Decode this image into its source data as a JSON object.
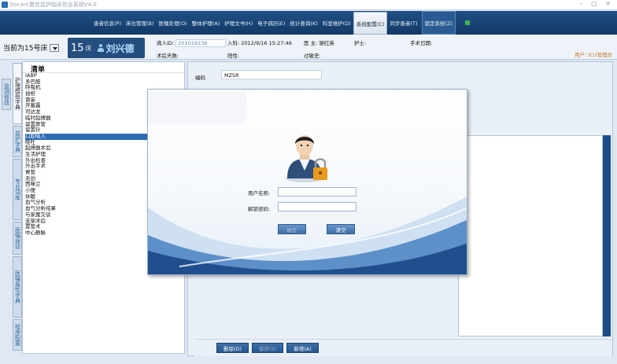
{
  "window": {
    "title": "Docare重症监护临床信息系统V4.0",
    "controls": "– ▢ ×"
  },
  "menu": {
    "items": [
      {
        "label": "患者信息(P)"
      },
      {
        "label": "床位管理(B)"
      },
      {
        "label": "医嘱处理(O)"
      },
      {
        "label": "整体护理(A)"
      },
      {
        "label": "护理文书(H)"
      },
      {
        "label": "电子病历(E)"
      },
      {
        "label": "统计查询(K)"
      },
      {
        "label": "科室维护(D)"
      },
      {
        "label": "系统配置(C)",
        "active": true
      },
      {
        "label": "同步患者(T)"
      },
      {
        "label": "锁定系统(Z)"
      }
    ]
  },
  "patient": {
    "bed_selector": "当前为15号床",
    "bed_number": "15",
    "bed_unit": "床",
    "name": "刘兴德",
    "id_label": "病人ID:",
    "id_value": "201019236",
    "admit_label": "入科:",
    "admit_value": "2012/9/16 15:27:46",
    "doctor_label": "医 主:",
    "doctor_value": "谢红英",
    "nurse_label": "护士:",
    "surgery_date_label": "手术日期:",
    "postop_days_label": "术后天数:",
    "positive_label": "阳性:",
    "allergy_label": "过敏史:",
    "user": "用户: ICU管理员"
  },
  "side_tabs": [
    {
      "label": "护理模板字典",
      "active": true
    },
    {
      "label": "监护字典"
    },
    {
      "label": "专业词库"
    },
    {
      "label": "医嘱途径"
    },
    {
      "label": "医嘱属性字典"
    },
    {
      "label": "程序配置"
    }
  ],
  "side_tab_left": "监测修改",
  "list": {
    "header": "清单",
    "items": [
      "IABP",
      "多巴胺",
      "呼吸机",
      "插桩",
      "谵妄",
      "开塞露",
      "司达龙",
      "临时起搏器",
      "留置尿管",
      "留置针",
      "口腔吸入",
      "呕吐",
      "起搏器术后",
      "生活护理",
      "外出检查",
      "外出手术",
      "胃管",
      "无创",
      "西咪兰",
      "小便",
      "休眠",
      "血气分析",
      "血气分析结果",
      "与家属交谈",
      "支架术后",
      "置管术",
      "中心静脉"
    ],
    "selected_index": 10
  },
  "editor": {
    "code_label": "编码",
    "code_value": "MZSR"
  },
  "buttons": {
    "delete": "删除(D)",
    "save": "保存(S)",
    "add": "新增(A)"
  },
  "dialog": {
    "username_label": "用户名称:",
    "password_label": "解锁密码:",
    "ok": "确定",
    "clear": "清空"
  }
}
